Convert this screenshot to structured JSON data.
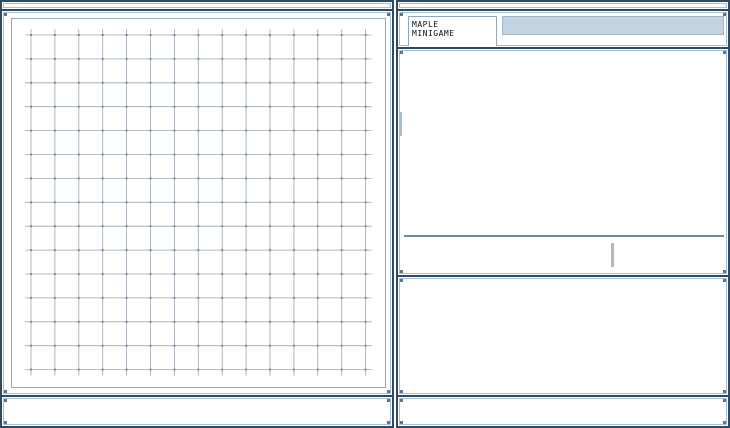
{
  "window": {
    "title_line1": "MAPLE",
    "title_line2": "MINIGAME"
  },
  "board": {
    "type": "omok-grid",
    "columns": 15,
    "rows": 15
  },
  "colors": {
    "frame": "#2c4a63",
    "frame_inner": "#a9bfd0",
    "grid": "#9aa7b2",
    "tab_bar": "#c4d3e0"
  }
}
